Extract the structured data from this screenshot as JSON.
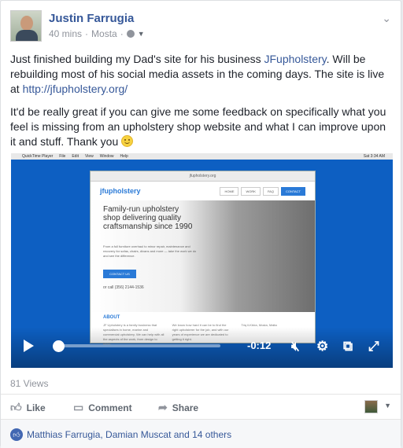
{
  "post": {
    "author": "Justin Farrugia",
    "time": "40 mins",
    "location": "Mosta",
    "separator": "·",
    "para1_pre": "Just finished building my Dad's site for his business ",
    "para1_link": "JFupholstery",
    "para1_mid": ". Will be rebuilding most of his social media assets in the coming days. The site is live at ",
    "para1_url": "http://jfupholstery.org/",
    "para2": "It'd be really great if you can give me some feedback on specifically what you feel is missing from an upholstery shop website and what I can improve upon it and stuff. Thank you "
  },
  "video": {
    "macbar": [
      "QuickTime Player",
      "File",
      "Edit",
      "View",
      "Window",
      "Help"
    ],
    "macbar_right": "Sat 3:34 AM",
    "url": "jfupholstery.org",
    "site": {
      "logo": "jfupholstery",
      "tabs": [
        "HOME",
        "WORK",
        "FAQ",
        "CONTACT"
      ],
      "hero_title": "Family-run upholstery shop delivering quality craftsmanship since 1990",
      "hero_sub": "From a full furniture overhaul to minor repair, maintenance and recovery for sofas, chairs, divans and more — take the work we do and see the difference.",
      "hero_btn": "CONTACT US",
      "hero_call": "or call (356) 2144-1536",
      "about_heading": "ABOUT",
      "about_col1": "JF Upholstery is a family business that specialises in home, marine and commercial upholstery. We can help with all the aspects of the work, from design to finish.",
      "about_col2": "We know how hard it can be to find the right upholsterer for the job, and with our years of experience we are dedicated to getting it right.",
      "about_col3": "Triq il-Kbira, Mosta, Malta"
    },
    "time": "-0:12",
    "progress": 0.02
  },
  "views": "81 Views",
  "actions": {
    "like": "Like",
    "comment": "Comment",
    "share": "Share"
  },
  "likes": "Matthias Farrugia, Damian Muscat and 14 others",
  "colors": {
    "link": "#365899",
    "video_bg": "#0d5fc2",
    "like_badge": "#4267b2"
  },
  "icons": [
    "globe-icon",
    "caret-down-icon",
    "chevron-down-icon",
    "smiley-icon",
    "play-icon",
    "mute-icon",
    "settings-icon",
    "cast-icon",
    "fullscreen-icon",
    "like-icon",
    "comment-icon",
    "share-icon"
  ]
}
